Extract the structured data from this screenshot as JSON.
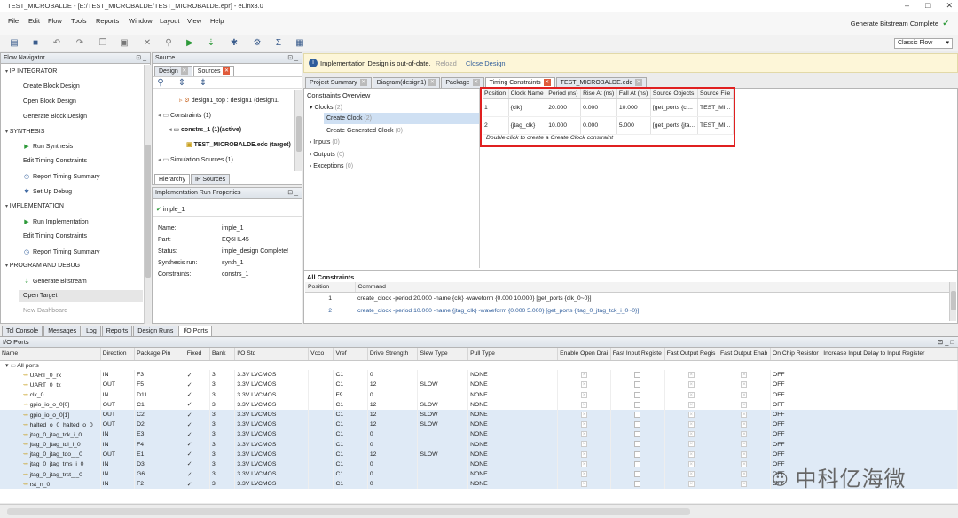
{
  "window": {
    "title": "TEST_MICROBALDE - [E:/TEST_MICROBALDE/TEST_MICROBALDE.epr] - eLinx3.0"
  },
  "menu": [
    "File",
    "Edit",
    "Flow",
    "Tools",
    "Reports",
    "Window",
    "Layout",
    "View",
    "Help"
  ],
  "status": {
    "text": "Generate Bitstream Complete"
  },
  "flow_selector": {
    "value": "Classic Flow"
  },
  "flow_navigator": {
    "title": "Flow Navigator",
    "sections": {
      "ip": "IP INTEGRATOR",
      "synth": "SYNTHESIS",
      "impl": "IMPLEMENTATION",
      "prog": "PROGRAM AND DEBUG"
    },
    "items": {
      "create_block": "Create Block Design",
      "open_block": "Open Block Design",
      "gen_block": "Generate Block Design",
      "run_synth": "Run Synthesis",
      "edit_tc_1": "Edit Timing Constraints",
      "report_ts_1": "Report Timing Summary",
      "setup_debug": "Set Up Debug",
      "run_impl": "Run Implementation",
      "edit_tc_2": "Edit Timing Constraints",
      "report_ts_2": "Report Timing Summary",
      "gen_bit": "Generate Bitstream",
      "open_target": "Open Target",
      "new_dash": "New Dashboard"
    }
  },
  "source": {
    "title": "Source",
    "tabs": [
      "Design",
      "Sources"
    ],
    "tree": {
      "top": "design1_top : design1 (design1.",
      "constraints": "Constraints (1)",
      "constrs": "constrs_1 (1)(active)",
      "edc": "TEST_MICROBALDE.edc (target)",
      "sim": "Simulation Sources (1)"
    },
    "bottom_tabs": [
      "Hierarchy",
      "IP Sources"
    ]
  },
  "run_props": {
    "title": "Implementation Run Properties",
    "run": "imple_1",
    "rows": [
      {
        "k": "Name:",
        "v": "imple_1"
      },
      {
        "k": "Part:",
        "v": "EQ6HL45"
      },
      {
        "k": "Status:",
        "v": "imple_design Complete!"
      },
      {
        "k": "Synthesis run:",
        "v": "synth_1"
      },
      {
        "k": "Constraints:",
        "v": "constrs_1"
      }
    ]
  },
  "banner": {
    "text": "Implementation Design is out-of-date.",
    "reload": "Reload",
    "close": "Close Design"
  },
  "editor_tabs": [
    "Project Summary",
    "Diagram(design1)",
    "Package",
    "Timing Constraints",
    "TEST_MICROBALDE.edc"
  ],
  "constraints_overview": {
    "title": "Constraints Overview",
    "clocks": "Clocks",
    "clocks_count": "(2)",
    "create_clock": "Create Clock",
    "create_clock_count": "(2)",
    "gen_clock": "Create Generated Clock",
    "gen_clock_count": "(0)",
    "inputs": "Inputs",
    "inputs_count": "(0)",
    "outputs": "Outputs",
    "outputs_count": "(0)",
    "exceptions": "Exceptions",
    "exceptions_count": "(0)"
  },
  "timing_table": {
    "headers": [
      "Position",
      "Clock Name",
      "Period (ns)",
      "Rise At (ns)",
      "Fall At (ns)",
      "Source Objects",
      "Source File"
    ],
    "rows": [
      [
        "1",
        "{clk}",
        "20.000",
        "0.000",
        "10.000",
        "[get_ports {cl...",
        "TEST_MI..."
      ],
      [
        "2",
        "{jtag_clk}",
        "10.000",
        "0.000",
        "5.000",
        "[get_ports {jta...",
        "TEST_MI..."
      ]
    ],
    "hint": "Double click to create a Create Clock constraint"
  },
  "all_constraints": {
    "title": "All Constraints",
    "headers": [
      "Position",
      "Command"
    ],
    "rows": [
      [
        "1",
        "create_clock -period 20.000 -name {clk} -waveform {0.000 10.000} [get_ports {clk_0~0}]"
      ],
      [
        "2",
        "create_clock -period 10.000 -name {jtag_clk} -waveform {0.000 5.000} [get_ports {jtag_0_jtag_tck_i_0~0}]"
      ]
    ]
  },
  "bottom_tabs": [
    "Tcl Console",
    "Messages",
    "Log",
    "Reports",
    "Design Runs",
    "I/O Ports"
  ],
  "io_ports": {
    "title": "I/O Ports",
    "headers": [
      "Name",
      "Direction",
      "Package Pin",
      "Fixed",
      "Bank",
      "I/O Std",
      "Vcco",
      "Vref",
      "Drive Strength",
      "Slew Type",
      "Pull Type",
      "Enable Open Drai",
      "Fast Input Registe",
      "Fast Output Regis",
      "Fast Output Enab",
      "On Chip Resistor",
      "Increase Input Delay to Input Register"
    ],
    "group": "All ports",
    "rows": [
      {
        "name": "UART_0_rx",
        "dir": "IN",
        "pin": "F3",
        "bank": "3",
        "std": "3.3V LVCMOS",
        "vref": "C1",
        "drive": "0",
        "slew": "",
        "pull": "NONE",
        "ocr": "OFF",
        "sel": false
      },
      {
        "name": "UART_0_tx",
        "dir": "OUT",
        "pin": "F5",
        "bank": "3",
        "std": "3.3V LVCMOS",
        "vref": "C1",
        "drive": "12",
        "slew": "SLOW",
        "pull": "NONE",
        "ocr": "OFF",
        "sel": false
      },
      {
        "name": "clk_0",
        "dir": "IN",
        "pin": "D11",
        "bank": "3",
        "std": "3.3V LVCMOS",
        "vref": "F9",
        "drive": "0",
        "slew": "",
        "pull": "NONE",
        "ocr": "OFF",
        "sel": false
      },
      {
        "name": "gpio_io_o_0[0]",
        "dir": "OUT",
        "pin": "C1",
        "bank": "3",
        "std": "3.3V LVCMOS",
        "vref": "C1",
        "drive": "12",
        "slew": "SLOW",
        "pull": "NONE",
        "ocr": "OFF",
        "sel": false
      },
      {
        "name": "gpio_io_o_0[1]",
        "dir": "OUT",
        "pin": "C2",
        "bank": "3",
        "std": "3.3V LVCMOS",
        "vref": "C1",
        "drive": "12",
        "slew": "SLOW",
        "pull": "NONE",
        "ocr": "OFF",
        "sel": true
      },
      {
        "name": "halted_o_0_halted_o_0",
        "dir": "OUT",
        "pin": "D2",
        "bank": "3",
        "std": "3.3V LVCMOS",
        "vref": "C1",
        "drive": "12",
        "slew": "SLOW",
        "pull": "NONE",
        "ocr": "OFF",
        "sel": true
      },
      {
        "name": "jtag_0_jtag_tck_i_0",
        "dir": "IN",
        "pin": "E3",
        "bank": "3",
        "std": "3.3V LVCMOS",
        "vref": "C1",
        "drive": "0",
        "slew": "",
        "pull": "NONE",
        "ocr": "OFF",
        "sel": true
      },
      {
        "name": "jtag_0_jtag_tdi_i_0",
        "dir": "IN",
        "pin": "F4",
        "bank": "3",
        "std": "3.3V LVCMOS",
        "vref": "C1",
        "drive": "0",
        "slew": "",
        "pull": "NONE",
        "ocr": "OFF",
        "sel": true
      },
      {
        "name": "jtag_0_jtag_tdo_i_0",
        "dir": "OUT",
        "pin": "E1",
        "bank": "3",
        "std": "3.3V LVCMOS",
        "vref": "C1",
        "drive": "12",
        "slew": "SLOW",
        "pull": "NONE",
        "ocr": "OFF",
        "sel": true
      },
      {
        "name": "jtag_0_jtag_tms_i_0",
        "dir": "IN",
        "pin": "D3",
        "bank": "3",
        "std": "3.3V LVCMOS",
        "vref": "C1",
        "drive": "0",
        "slew": "",
        "pull": "NONE",
        "ocr": "OFF",
        "sel": true
      },
      {
        "name": "jtag_0_jtag_trst_i_0",
        "dir": "IN",
        "pin": "G6",
        "bank": "3",
        "std": "3.3V LVCMOS",
        "vref": "C1",
        "drive": "0",
        "slew": "",
        "pull": "NONE",
        "ocr": "OFF",
        "sel": true
      },
      {
        "name": "rst_n_0",
        "dir": "IN",
        "pin": "F2",
        "bank": "3",
        "std": "3.3V LVCMOS",
        "vref": "C1",
        "drive": "0",
        "slew": "",
        "pull": "NONE",
        "ocr": "OFF",
        "sel": true
      }
    ]
  },
  "watermark": "中科亿海微",
  "colors": {
    "accent": "#2f5d9b",
    "highlight": "#e02020",
    "selected": "#dfeaf6",
    "green": "#2e9a3a"
  }
}
